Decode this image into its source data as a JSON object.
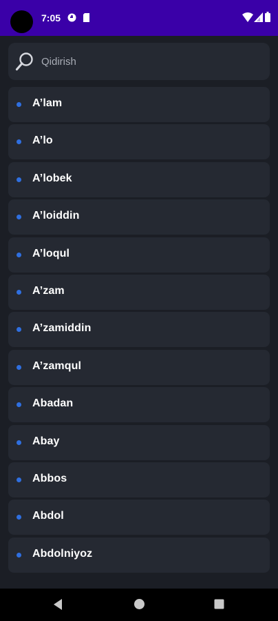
{
  "status_bar": {
    "time": "7:05",
    "background": "#3a00a8"
  },
  "search": {
    "placeholder": "Qidirish",
    "value": ""
  },
  "names": [
    "A’lam",
    "A’lo",
    "A’lobek",
    "A’loiddin",
    "A’loqul",
    "A’zam",
    "A’zamiddin",
    "A’zamqul",
    "Abadan",
    "Abay",
    "Abbos",
    "Abdol",
    "Abdolniyoz"
  ],
  "colors": {
    "background": "#1b1e25",
    "card": "#252932",
    "bullet": "#2f6fe0",
    "text": "#ffffff"
  },
  "icons": {
    "status": [
      "vpn-key-icon",
      "sim-card-icon",
      "wifi-icon",
      "signal-icon",
      "battery-icon"
    ],
    "search": "search-icon",
    "nav": [
      "back-icon",
      "home-icon",
      "recents-icon"
    ]
  }
}
